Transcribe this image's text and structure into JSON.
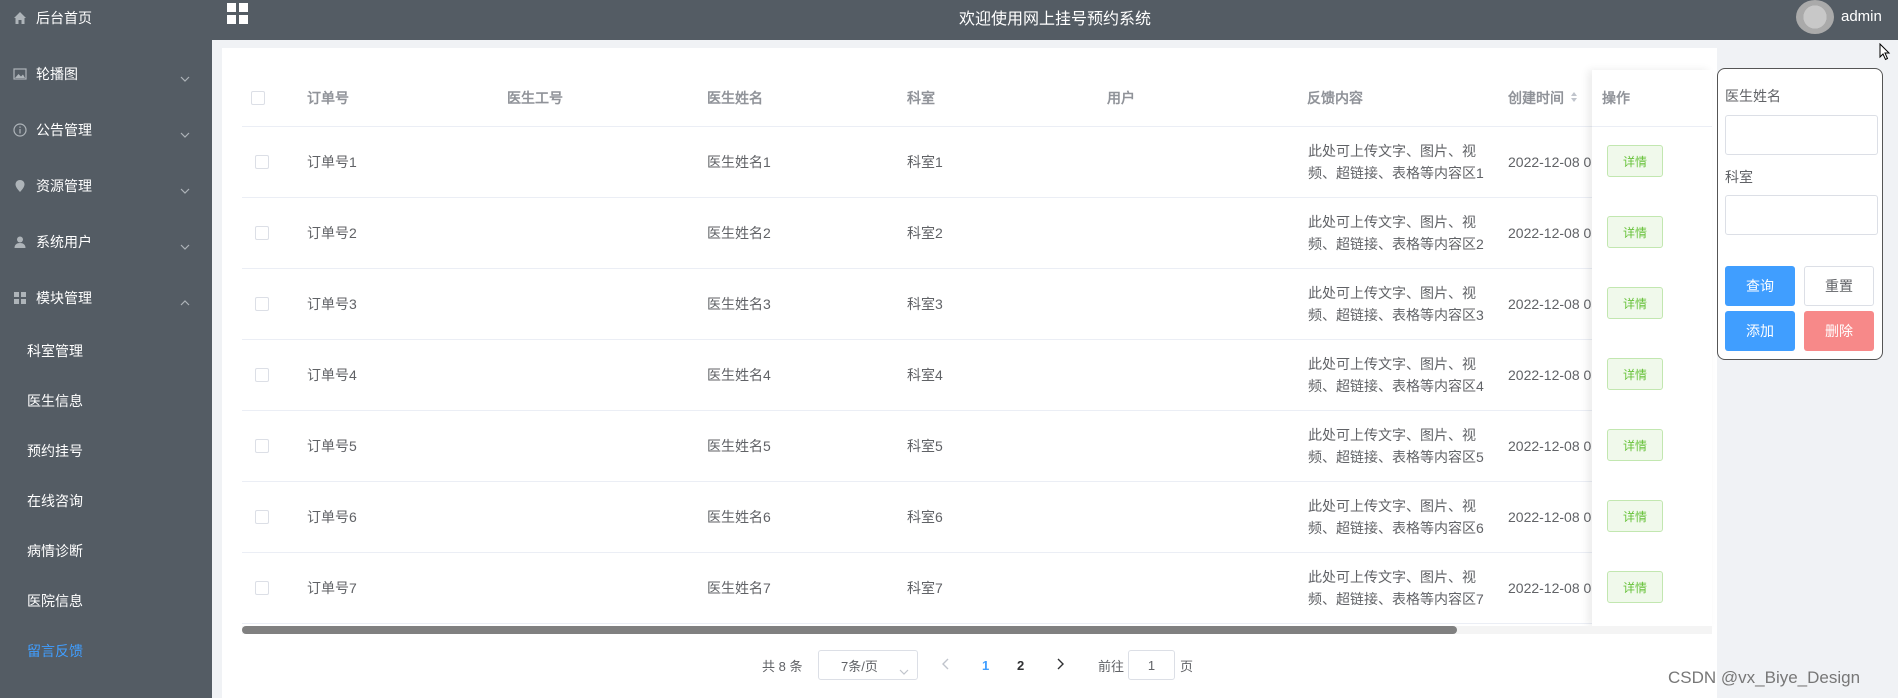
{
  "header": {
    "title": "欢迎使用网上挂号预约系统",
    "username": "admin"
  },
  "sidebar": {
    "items": [
      {
        "label": "后台首页",
        "icon": "home-icon"
      },
      {
        "label": "轮播图",
        "icon": "picture-icon"
      },
      {
        "label": "公告管理",
        "icon": "info-icon"
      },
      {
        "label": "资源管理",
        "icon": "location-icon"
      },
      {
        "label": "系统用户",
        "icon": "user-icon"
      },
      {
        "label": "模块管理",
        "icon": "grid-icon"
      }
    ],
    "sub_items": [
      "科室管理",
      "医生信息",
      "预约挂号",
      "在线咨询",
      "病情诊断",
      "医院信息",
      "留言反馈"
    ],
    "active_sub": "留言反馈"
  },
  "table": {
    "columns": [
      "订单号",
      "医生工号",
      "医生姓名",
      "科室",
      "用户",
      "反馈内容",
      "创建时间",
      "操作"
    ],
    "detail_label": "详情",
    "rows": [
      {
        "order": "订单号1",
        "doctor_no": "",
        "doctor": "医生姓名1",
        "dept": "科室1",
        "user": "",
        "content1": "此处可上传文字、图片、视",
        "content2": "频、超链接、表格等内容区1",
        "time": "2022-12-08 0"
      },
      {
        "order": "订单号2",
        "doctor_no": "",
        "doctor": "医生姓名2",
        "dept": "科室2",
        "user": "",
        "content1": "此处可上传文字、图片、视",
        "content2": "频、超链接、表格等内容区2",
        "time": "2022-12-08 0"
      },
      {
        "order": "订单号3",
        "doctor_no": "",
        "doctor": "医生姓名3",
        "dept": "科室3",
        "user": "",
        "content1": "此处可上传文字、图片、视",
        "content2": "频、超链接、表格等内容区3",
        "time": "2022-12-08 0"
      },
      {
        "order": "订单号4",
        "doctor_no": "",
        "doctor": "医生姓名4",
        "dept": "科室4",
        "user": "",
        "content1": "此处可上传文字、图片、视",
        "content2": "频、超链接、表格等内容区4",
        "time": "2022-12-08 0"
      },
      {
        "order": "订单号5",
        "doctor_no": "",
        "doctor": "医生姓名5",
        "dept": "科室5",
        "user": "",
        "content1": "此处可上传文字、图片、视",
        "content2": "频、超链接、表格等内容区5",
        "time": "2022-12-08 0"
      },
      {
        "order": "订单号6",
        "doctor_no": "",
        "doctor": "医生姓名6",
        "dept": "科室6",
        "user": "",
        "content1": "此处可上传文字、图片、视",
        "content2": "频、超链接、表格等内容区6",
        "time": "2022-12-08 0"
      },
      {
        "order": "订单号7",
        "doctor_no": "",
        "doctor": "医生姓名7",
        "dept": "科室7",
        "user": "",
        "content1": "此处可上传文字、图片、视",
        "content2": "频、超链接、表格等内容区7",
        "time": "2022-12-08 0"
      }
    ]
  },
  "pagination": {
    "total": "共 8 条",
    "page_size": "7条/页",
    "pages": [
      "1",
      "2"
    ],
    "current": "1",
    "goto_prefix": "前往",
    "goto_value": "1",
    "goto_suffix": "页"
  },
  "filter": {
    "doctor_label": "医生姓名",
    "dept_label": "科室",
    "search_label": "查询",
    "reset_label": "重置",
    "add_label": "添加",
    "delete_label": "删除"
  },
  "colors": {
    "primary": "#409eff",
    "danger": "#f78989",
    "success": "#67c23a",
    "sidebar_bg": "#545c64"
  },
  "watermark": "CSDN @vx_Biye_Design"
}
